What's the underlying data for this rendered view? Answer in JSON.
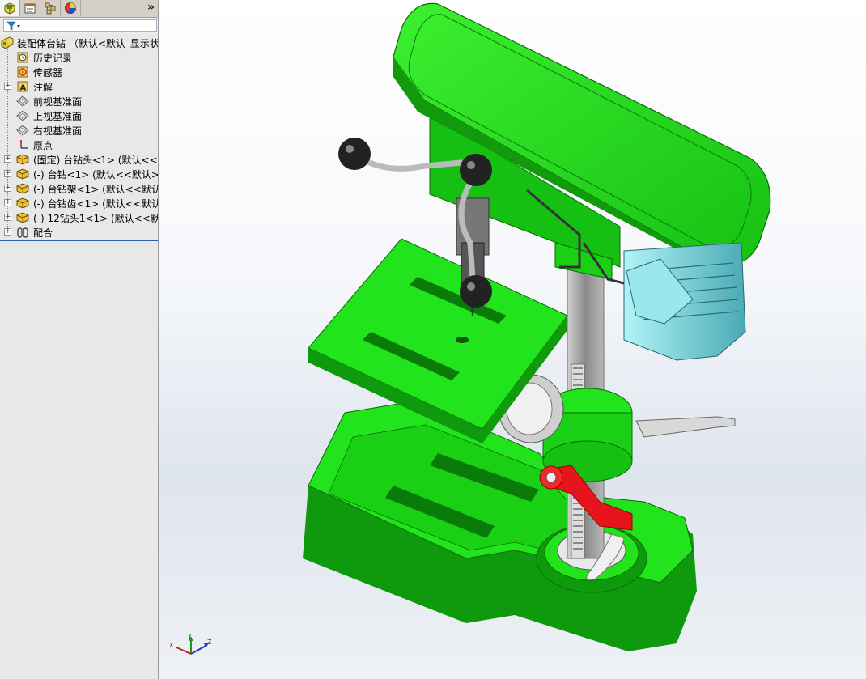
{
  "panel": {
    "tabs": [
      {
        "icon": "feature-manager-icon"
      },
      {
        "icon": "property-manager-icon"
      },
      {
        "icon": "configuration-manager-icon"
      },
      {
        "icon": "display-manager-icon"
      }
    ],
    "more_glyph": "»",
    "tree": {
      "root_label": "装配体台钻 （默认<默认_显示状",
      "items": [
        {
          "label": "历史记录",
          "icon": "history-icon"
        },
        {
          "label": "传感器",
          "icon": "sensor-icon"
        },
        {
          "label": "注解",
          "icon": "annotation-icon"
        },
        {
          "label": "前视基准面",
          "icon": "plane-icon"
        },
        {
          "label": "上视基准面",
          "icon": "plane-icon"
        },
        {
          "label": "右视基准面",
          "icon": "plane-icon"
        },
        {
          "label": "原点",
          "icon": "origin-icon"
        },
        {
          "label": "(固定) 台钻头<1> (默认<<默",
          "icon": "part-icon"
        },
        {
          "label": "(-) 台钻<1> (默认<<默认>_",
          "icon": "part-icon"
        },
        {
          "label": "(-) 台钻架<1> (默认<<默认",
          "icon": "part-icon"
        },
        {
          "label": "(-) 台钻齿<1> (默认<<默认",
          "icon": "part-icon"
        },
        {
          "label": "(-) 12钻头1<1> (默认<<默认",
          "icon": "part-icon"
        },
        {
          "label": "配合",
          "icon": "mates-icon"
        }
      ]
    }
  },
  "triad": {
    "x": "X",
    "y": "Y",
    "z": "Z"
  },
  "colors": {
    "part_green": "#22e41c",
    "dark_green": "#109a0c",
    "red_handle": "#e8141c",
    "motor_cyan": "#8fe0e6",
    "column_gray": "#a8a8a8"
  }
}
